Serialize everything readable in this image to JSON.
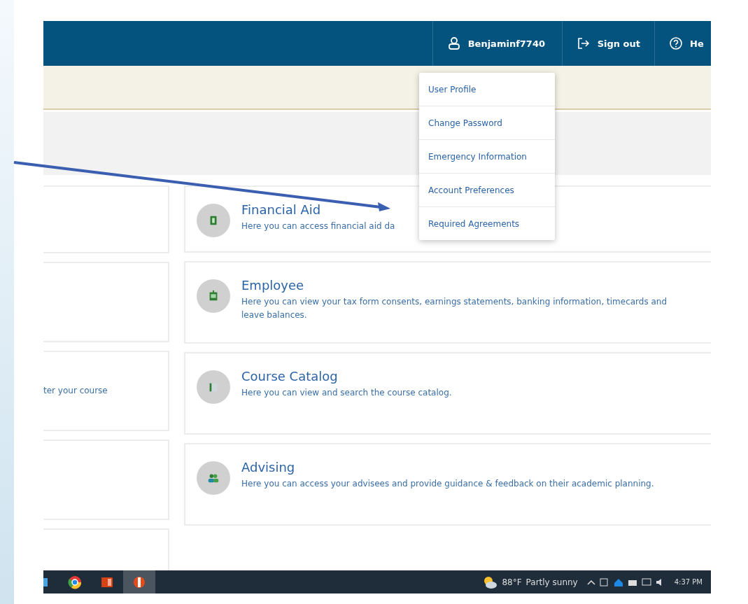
{
  "header": {
    "user_name": "Benjaminf7740",
    "sign_out": "Sign out",
    "help": "He"
  },
  "user_menu": {
    "items": [
      "User Profile",
      "Change Password",
      "Emergency Information",
      "Account Preferences",
      "Required Agreements"
    ]
  },
  "left_column_text": "ter your course",
  "cards": [
    {
      "title": "Financial Aid",
      "description": "Here you can access financial aid da"
    },
    {
      "title": "Employee",
      "description": "Here you can view your tax form consents, earnings statements, banking information, timecards and leave balances."
    },
    {
      "title": "Course Catalog",
      "description": "Here you can view and search the course catalog."
    },
    {
      "title": "Advising",
      "description": "Here you can access your advisees and provide guidance & feedback on their academic planning."
    }
  ],
  "taskbar": {
    "apps": [
      {
        "selected": false
      },
      {
        "selected": false
      },
      {
        "selected": false
      },
      {
        "selected": true
      }
    ],
    "temperature": "88°F",
    "weather": "Partly sunny",
    "time": "4:37 PM"
  }
}
